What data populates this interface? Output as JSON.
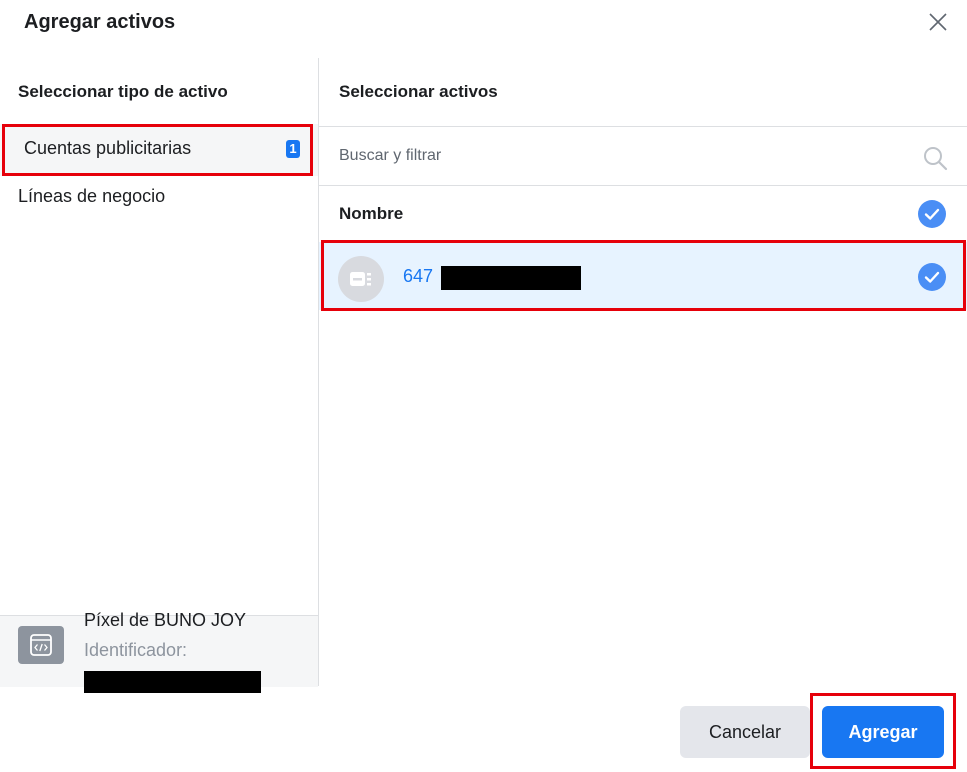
{
  "dialog": {
    "title": "Agregar activos",
    "close_icon": "close-icon"
  },
  "left_panel": {
    "heading": "Seleccionar tipo de activo",
    "asset_types": [
      {
        "label": "Cuentas publicitarias",
        "badge": "1",
        "selected": true
      },
      {
        "label": "Líneas de negocio",
        "selected": false
      }
    ],
    "pixel": {
      "icon": "code-window-icon",
      "name": "Píxel de BUNO JOY",
      "id_label": "Identificador:"
    }
  },
  "right_panel": {
    "heading": "Seleccionar activos",
    "search": {
      "placeholder": "Buscar y filtrar",
      "value": "",
      "icon": "search-icon"
    },
    "column_header": "Nombre",
    "assets": [
      {
        "name": "647",
        "icon": "ad-account-icon",
        "selected": true
      }
    ]
  },
  "footer": {
    "cancel_label": "Cancelar",
    "add_label": "Agregar"
  },
  "colors": {
    "primary": "#1877f2",
    "highlight": "#e6000a",
    "selected_row": "#e7f3ff",
    "check": "#4a8ef5"
  }
}
